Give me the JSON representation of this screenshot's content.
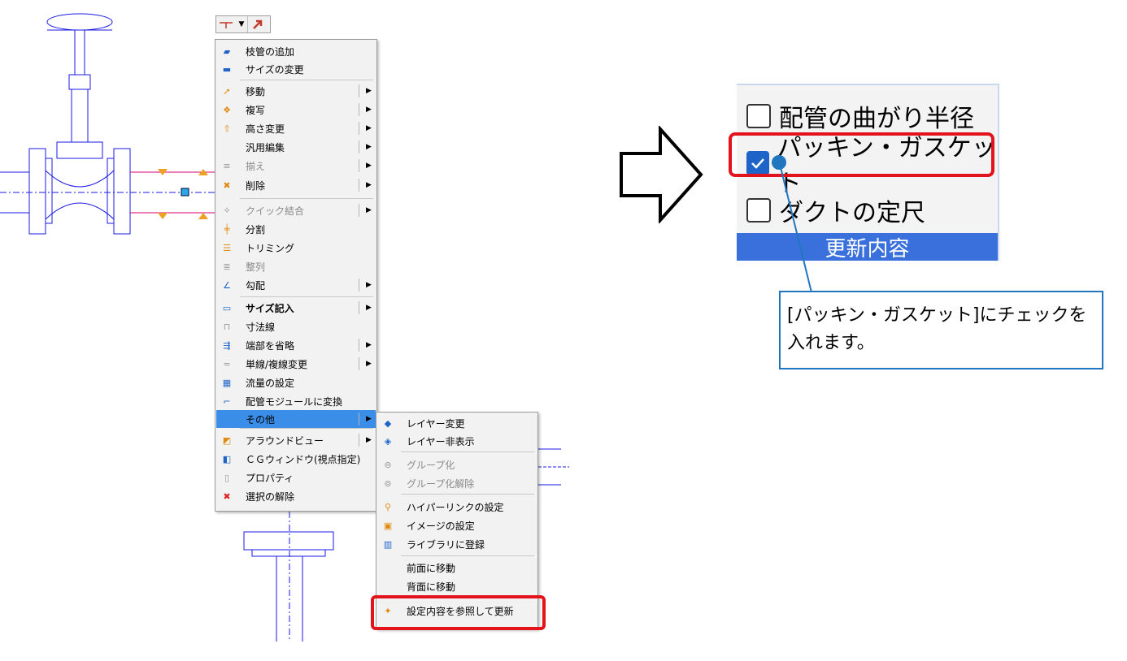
{
  "toolbar": {
    "pipe_icon": "pipe-tee-icon",
    "dropdown_icon": "chevron-down-icon",
    "arrow_icon": "select-arrow-icon",
    "accent_color": "#c0392b"
  },
  "context_menu": {
    "items": [
      {
        "label": "枝管の追加",
        "icon": "branch-pipe-icon"
      },
      {
        "label": "サイズの変更",
        "icon": "size-change-icon"
      },
      {
        "label": "移動",
        "icon": "move-icon",
        "submenu": true
      },
      {
        "label": "複写",
        "icon": "copy-icon",
        "submenu": true
      },
      {
        "label": "高さ変更",
        "icon": "height-change-icon",
        "submenu": true
      },
      {
        "label": "汎用編集",
        "icon": "",
        "submenu": true
      },
      {
        "label": "揃え",
        "icon": "align-icon",
        "submenu": true,
        "disabled": true
      },
      {
        "label": "削除",
        "icon": "delete-icon",
        "submenu": true
      },
      {
        "label": "クイック結合",
        "icon": "quick-join-icon",
        "submenu": true,
        "disabled": true
      },
      {
        "label": "分割",
        "icon": "split-icon"
      },
      {
        "label": "トリミング",
        "icon": "trim-icon"
      },
      {
        "label": "整列",
        "icon": "arrange-icon",
        "disabled": true
      },
      {
        "label": "勾配",
        "icon": "slope-icon",
        "submenu": true
      },
      {
        "label": "サイズ記入",
        "icon": "size-label-icon",
        "submenu": true,
        "bold": true
      },
      {
        "label": "寸法線",
        "icon": "dimension-line-icon"
      },
      {
        "label": "端部を省略",
        "icon": "omit-end-icon",
        "submenu": true
      },
      {
        "label": "単線/複線変更",
        "icon": "line-toggle-icon",
        "submenu": true
      },
      {
        "label": "流量の設定",
        "icon": "flow-rate-icon"
      },
      {
        "label": "配管モジュールに変換",
        "icon": "pipe-module-icon"
      },
      {
        "label": "その他",
        "icon": "",
        "submenu": true,
        "selected": true
      },
      {
        "label": "アラウンドビュー",
        "icon": "around-view-icon",
        "submenu": true
      },
      {
        "label": "ＣＧウィンドウ(視点指定)",
        "icon": "cg-window-icon"
      },
      {
        "label": "プロパティ",
        "icon": "property-icon"
      },
      {
        "label": "選択の解除",
        "icon": "deselect-icon"
      }
    ]
  },
  "submenu": {
    "items": [
      {
        "label": "レイヤー変更",
        "icon": "layer-change-icon"
      },
      {
        "label": "レイヤー非表示",
        "icon": "layer-hide-icon"
      },
      {
        "label": "グループ化",
        "icon": "group-icon",
        "disabled": true
      },
      {
        "label": "グループ化解除",
        "icon": "ungroup-icon",
        "disabled": true
      },
      {
        "label": "ハイパーリンクの設定",
        "icon": "hyperlink-icon"
      },
      {
        "label": "イメージの設定",
        "icon": "image-setting-icon"
      },
      {
        "label": "ライブラリに登録",
        "icon": "library-register-icon"
      },
      {
        "label": "前面に移動",
        "icon": ""
      },
      {
        "label": "背面に移動",
        "icon": ""
      },
      {
        "label": "設定内容を参照して更新",
        "icon": "refresh-settings-icon",
        "highlighted": true
      }
    ]
  },
  "settings_panel": {
    "options": [
      {
        "label": "配管の曲がり半径",
        "checked": false
      },
      {
        "label": "パッキン・ガスケット",
        "checked": true
      },
      {
        "label": "ダクトの定尺",
        "checked": false
      }
    ],
    "footer_label": "更新内容",
    "footer_color": "#3a70dc"
  },
  "callout": {
    "line1": "[パッキン・ガスケット]にチェックを",
    "line2": "入れます。"
  },
  "colors": {
    "highlight": "#e3131b",
    "cad_line": "#1a1ae6",
    "callout_border": "#2077c0"
  }
}
